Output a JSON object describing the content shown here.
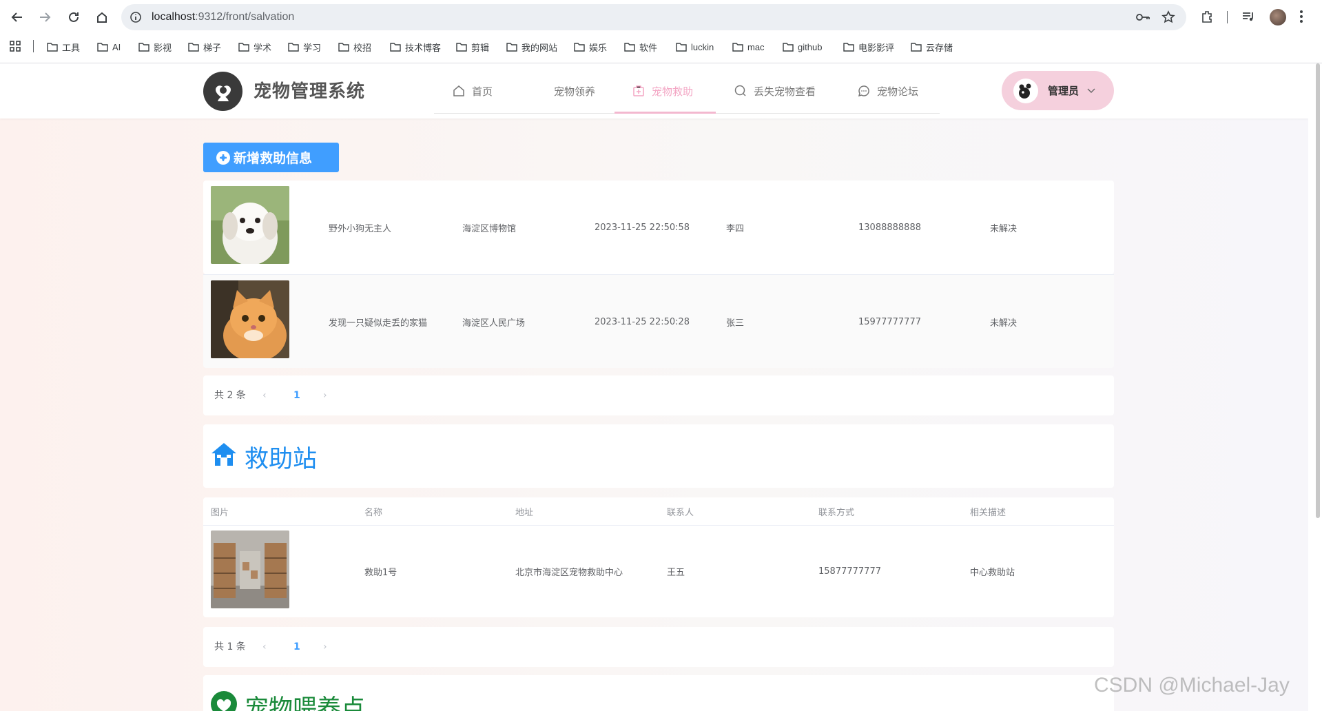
{
  "browser": {
    "url_host": "localhost",
    "url_rest": ":9312/front/salvation",
    "bookmarks": [
      "工具",
      "AI",
      "影视",
      "梯子",
      "学术",
      "学习",
      "校招",
      "技术博客",
      "剪辑",
      "我的网站",
      "娱乐",
      "软件",
      "luckin",
      "mac",
      "github",
      "电影影评",
      "云存储"
    ]
  },
  "site": {
    "title": "宠物管理系统"
  },
  "nav": [
    {
      "label": "首页",
      "icon": "home-icon"
    },
    {
      "label": "宠物领养",
      "icon": ""
    },
    {
      "label": "宠物救助",
      "icon": "medical-kit-icon",
      "active": true
    },
    {
      "label": "丢失宠物查看",
      "icon": "search-icon"
    },
    {
      "label": "宠物论坛",
      "icon": "chat-icon"
    }
  ],
  "user": {
    "name": "管理员"
  },
  "add_button": {
    "label": "新增救助信息"
  },
  "salvation_rows": [
    {
      "image": "puppy",
      "title": "野外小狗无主人",
      "place": "海淀区博物馆",
      "time": "2023-11-25 22:50:58",
      "contact": "李四",
      "phone": "13088888888",
      "status": "未解决"
    },
    {
      "image": "cat",
      "title": "发现一只疑似走丢的家猫",
      "place": "海淀区人民广场",
      "time": "2023-11-25 22:50:28",
      "contact": "张三",
      "phone": "15977777777",
      "status": "未解决"
    }
  ],
  "pager1": {
    "total": "共 2 条",
    "page": "1"
  },
  "station": {
    "title": "救助站",
    "icon": "house-icon"
  },
  "station_headers": [
    "图片",
    "名称",
    "地址",
    "联系人",
    "联系方式",
    "相关描述"
  ],
  "station_rows": [
    {
      "image": "warehouse",
      "name": "救助1号",
      "address": "北京市海淀区宠物救助中心",
      "contact": "王五",
      "phone": "15877777777",
      "desc": "中心救助站"
    }
  ],
  "pager2": {
    "total": "共 1 条",
    "page": "1"
  },
  "feeding": {
    "title": "宠物喂养点",
    "icon": "heart-icon"
  },
  "watermark": "CSDN @Michael-Jay",
  "colors": {
    "accent": "#409eff",
    "nav_active": "#f3a6c4",
    "user_pill": "#f5d0dd",
    "green": "#1a8a3a"
  }
}
